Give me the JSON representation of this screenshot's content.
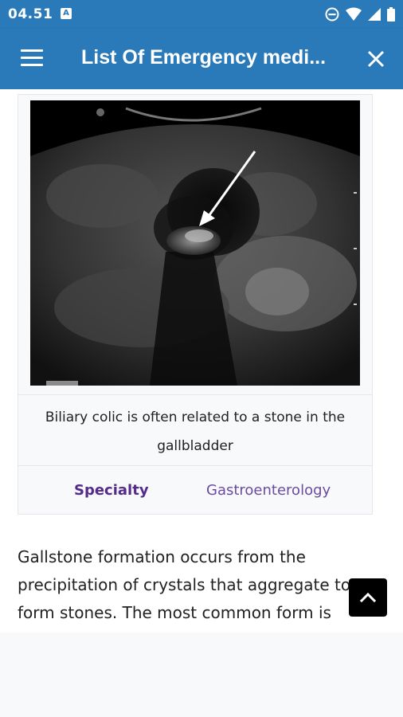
{
  "status_bar": {
    "time": "04.51",
    "notification_letter": "A",
    "icons": [
      "do-not-disturb-icon",
      "wifi-icon",
      "signal-icon",
      "battery-icon"
    ]
  },
  "app_bar": {
    "title": "List Of Emergency medi...",
    "menu_icon": "hamburger-menu-icon",
    "close_icon": "close-icon"
  },
  "infobox": {
    "image_alt": "Ultrasound image showing gallstone",
    "caption": "Biliary colic is often related to a stone in the gallbladder",
    "specialty_label": "Specialty",
    "specialty_value": "Gastroenterology"
  },
  "article": {
    "paragraph": "Gallstone formation occurs from the precipitation of crystals that aggregate to form stones. The most common form is"
  },
  "scroll_top": {
    "icon": "chevron-up-icon"
  },
  "colors": {
    "app_bar": "#2a7ab9",
    "label": "#542a8a",
    "link": "#6b4ba1",
    "text": "#202122"
  }
}
